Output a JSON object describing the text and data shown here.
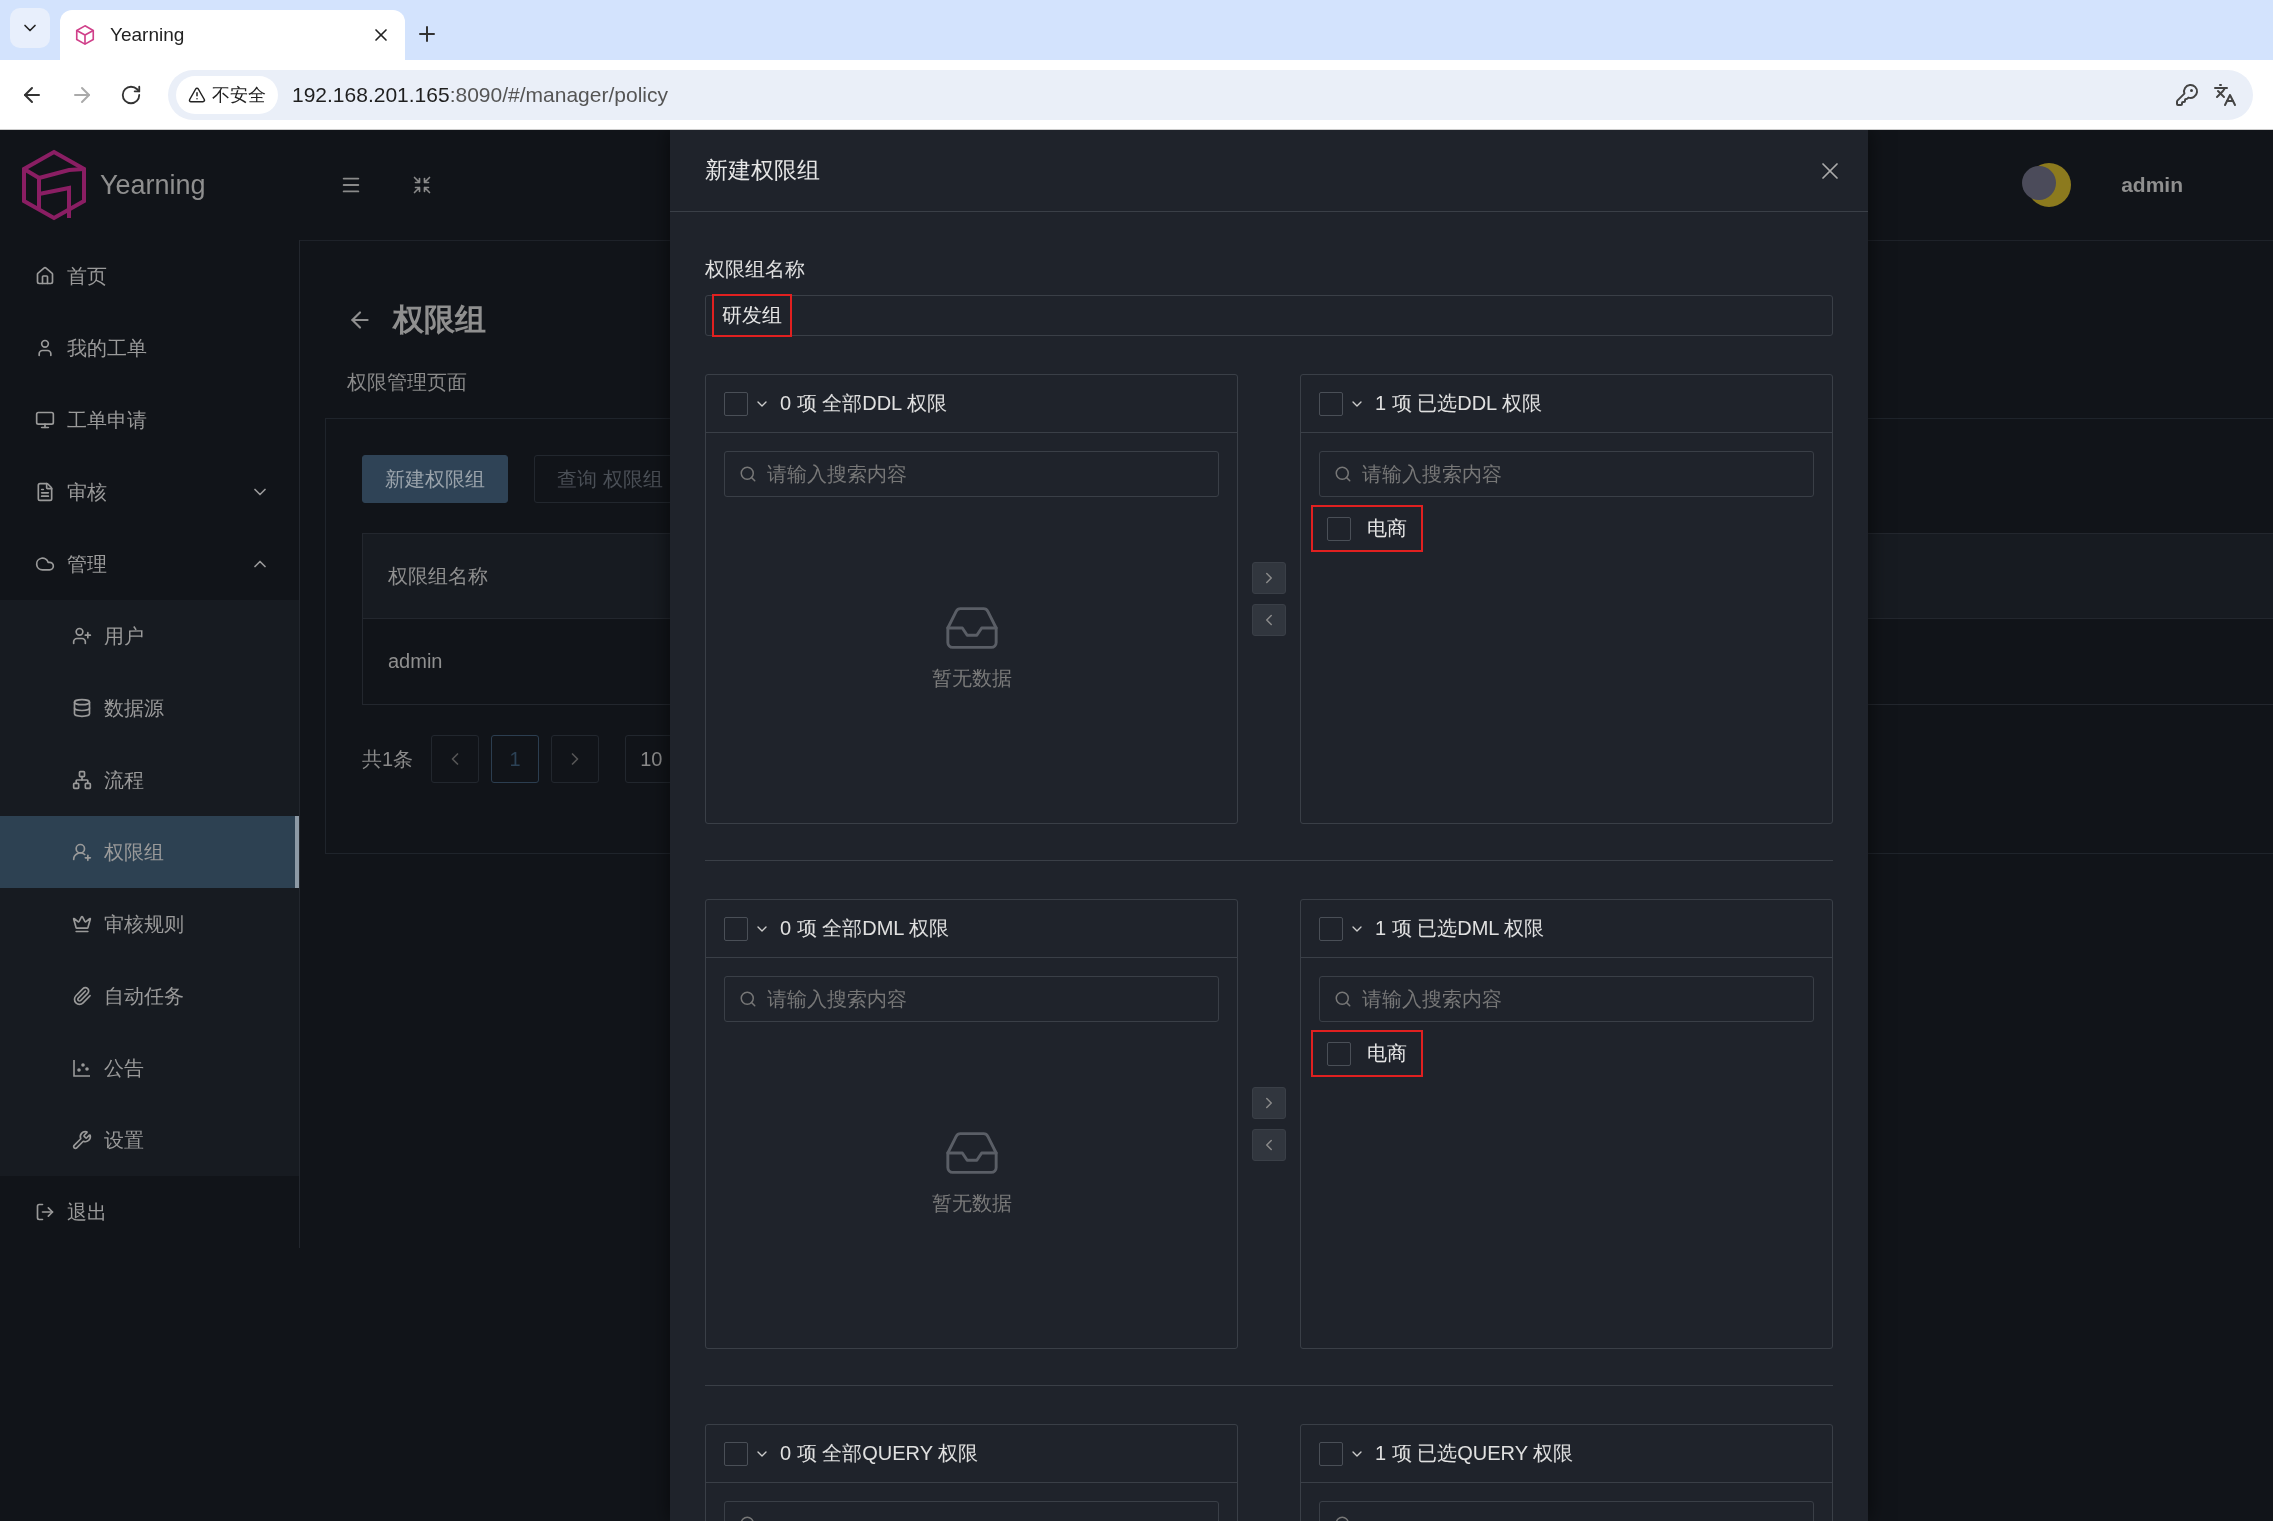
{
  "browser": {
    "tab": {
      "title": "Yearning"
    },
    "security_label": "不安全",
    "url_host": "192.168.201.165",
    "url_path": ":8090/#/manager/policy"
  },
  "app": {
    "logo_text": "Yearning",
    "user": "admin"
  },
  "sidebar": {
    "items": [
      {
        "label": "首页",
        "selected": false
      },
      {
        "label": "我的工单",
        "selected": false
      },
      {
        "label": "工单申请",
        "selected": false
      },
      {
        "label": "审核",
        "selected": false,
        "expanded": false
      },
      {
        "label": "管理",
        "selected": false,
        "expanded": true,
        "children": [
          {
            "label": "用户",
            "selected": false
          },
          {
            "label": "数据源",
            "selected": false
          },
          {
            "label": "流程",
            "selected": false
          },
          {
            "label": "权限组",
            "selected": true
          },
          {
            "label": "审核规则",
            "selected": false
          },
          {
            "label": "自动任务",
            "selected": false
          },
          {
            "label": "公告",
            "selected": false
          },
          {
            "label": "设置",
            "selected": false
          }
        ]
      },
      {
        "label": "退出",
        "selected": false
      }
    ]
  },
  "page": {
    "title": "权限组",
    "subtitle": "权限管理页面",
    "buttons": [
      "新建权限组",
      "查询 权限组"
    ],
    "table": {
      "columns": [
        "权限组名称"
      ],
      "rows": [
        [
          "admin"
        ]
      ]
    },
    "pagination": {
      "total": "共1条",
      "pages": [
        {
          "label": "1",
          "selected": true
        }
      ],
      "page_size": "10"
    }
  },
  "dialog": {
    "title": "新建权限组",
    "name_field": {
      "label": "权限组名称",
      "value": "研发组",
      "highlighted": true
    },
    "transfers": [
      {
        "source": {
          "header": "0 项 全部DDL 权限",
          "checked": false,
          "search_placeholder": "请输入搜索内容",
          "empty_text": "暂无数据"
        },
        "target": {
          "header": "1 项 已选DDL 权限",
          "checked": false,
          "search_placeholder": "请输入搜索内容",
          "items": [
            {
              "label": "电商",
              "checked": false,
              "highlighted": true
            }
          ]
        }
      },
      {
        "source": {
          "header": "0 项 全部DML 权限",
          "checked": false,
          "search_placeholder": "请输入搜索内容",
          "empty_text": "暂无数据"
        },
        "target": {
          "header": "1 项 已选DML 权限",
          "checked": false,
          "search_placeholder": "请输入搜索内容",
          "items": [
            {
              "label": "电商",
              "checked": false,
              "highlighted": true
            }
          ]
        }
      },
      {
        "source": {
          "header": "0 项 全部QUERY 权限",
          "checked": false
        },
        "target": {
          "header": "1 项 已选QUERY 权限",
          "checked": false
        }
      }
    ]
  }
}
